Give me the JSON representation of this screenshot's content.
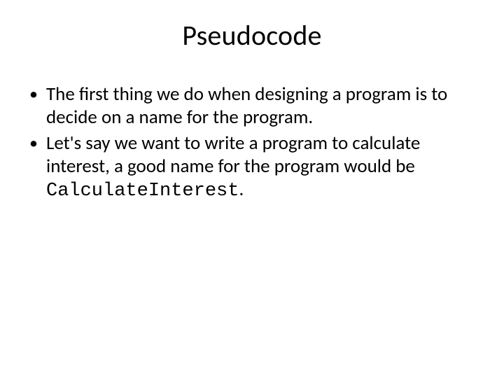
{
  "title": "Pseudocode",
  "bullets": [
    {
      "text": "The first thing we do when designing a program is to decide on a name for the program."
    },
    {
      "prefix": "Let's say we want to write a program to calculate interest, a good name for the program would be ",
      "code": "CalculateInterest",
      "suffix": "."
    }
  ]
}
